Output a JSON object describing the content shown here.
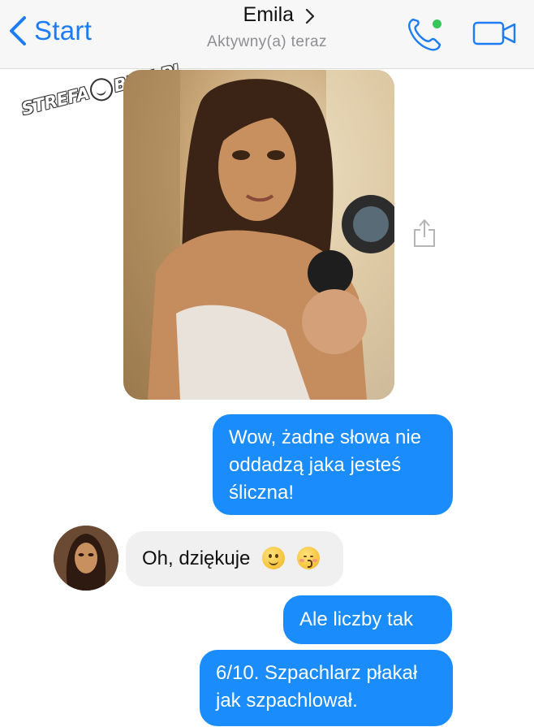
{
  "header": {
    "back_label": "Start",
    "contact_name": "Emila",
    "status": "Aktywny(a) teraz",
    "accent_color": "#1d7cf5",
    "online_color": "#35c759"
  },
  "watermark": {
    "left": "STREFA",
    "right": "BEKI.PL"
  },
  "messages": [
    {
      "side": "outgoing",
      "type": "photo",
      "icon": "shared-photo"
    },
    {
      "side": "outgoing",
      "lines": [
        "Wow, żadne słowa nie",
        "oddadzą jaka jesteś",
        "śliczna!"
      ]
    },
    {
      "side": "incoming",
      "text": "Oh, dziękuje",
      "emojis": [
        "slightly-smiling-face",
        "kissing-face-with-blush"
      ]
    },
    {
      "side": "outgoing",
      "text": "Ale liczby tak"
    },
    {
      "side": "outgoing",
      "lines": [
        "6/10. Szpachlarz płakał",
        "jak szpachlował."
      ]
    }
  ],
  "bubble_colors": {
    "outgoing": "#1a8cfc",
    "incoming": "#f0f0f0"
  }
}
